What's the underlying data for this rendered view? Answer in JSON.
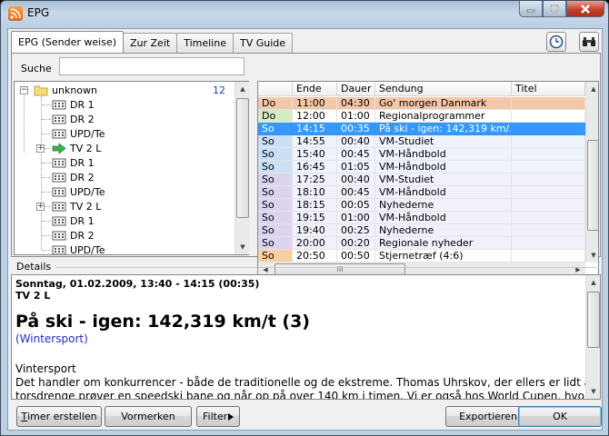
{
  "window": {
    "title": "EPG"
  },
  "tabs": [
    {
      "label": "EPG (Sender weise)",
      "active": true
    },
    {
      "label": "Zur Zeit",
      "active": false
    },
    {
      "label": "Timeline",
      "active": false
    },
    {
      "label": "TV Guide",
      "active": false
    }
  ],
  "toolbar": {
    "clock_icon": "clock-icon",
    "binoculars_icon": "binoculars-icon"
  },
  "search": {
    "label": "Suche",
    "value": ""
  },
  "tree": {
    "root": {
      "label": "unknown",
      "count": "12"
    },
    "items": [
      {
        "label": "DR 1"
      },
      {
        "label": "DR 2"
      },
      {
        "label": "UPD/Te"
      },
      {
        "label": "TV 2 L",
        "current": true
      },
      {
        "label": "DR 1"
      },
      {
        "label": "DR 2"
      },
      {
        "label": "UPD/Te"
      },
      {
        "label": "TV 2 L"
      },
      {
        "label": "DR 1"
      },
      {
        "label": "DR 2"
      },
      {
        "label": "UPD/Te"
      }
    ]
  },
  "grid": {
    "headers": [
      "",
      "Ende",
      "Dauer",
      "Sendung",
      "Titel"
    ],
    "rows": [
      {
        "day": "Do",
        "end": "11:00",
        "dur": "04:30",
        "show": "Go' morgen Danmark",
        "title": "",
        "style": "orange"
      },
      {
        "day": "Do",
        "end": "12:00",
        "dur": "01:00",
        "show": "Regionalprogrammer",
        "title": "",
        "style": "green"
      },
      {
        "day": "So",
        "end": "14:15",
        "dur": "00:35",
        "show": "På ski - igen: 142,319 km/...",
        "title": "",
        "style": "selected"
      },
      {
        "day": "So",
        "end": "14:55",
        "dur": "00:40",
        "show": "VM-Studiet",
        "title": "",
        "style": "blue"
      },
      {
        "day": "So",
        "end": "15:40",
        "dur": "00:45",
        "show": "VM-Håndbold",
        "title": "",
        "style": "blue"
      },
      {
        "day": "So",
        "end": "16:45",
        "dur": "01:05",
        "show": "VM-Håndbold",
        "title": "",
        "style": "blue"
      },
      {
        "day": "So",
        "end": "17:25",
        "dur": "00:40",
        "show": "VM-Studiet",
        "title": "",
        "style": "purple"
      },
      {
        "day": "So",
        "end": "18:10",
        "dur": "00:45",
        "show": "VM-Håndbold",
        "title": "",
        "style": "purple"
      },
      {
        "day": "So",
        "end": "18:15",
        "dur": "00:05",
        "show": "Nyhederne",
        "title": "",
        "style": "purple"
      },
      {
        "day": "So",
        "end": "19:15",
        "dur": "01:00",
        "show": "VM-Håndbold",
        "title": "",
        "style": "purple"
      },
      {
        "day": "So",
        "end": "19:40",
        "dur": "00:25",
        "show": "Nyhederne",
        "title": "",
        "style": "purple"
      },
      {
        "day": "So",
        "end": "20:00",
        "dur": "00:20",
        "show": "Regionale nyheder",
        "title": "",
        "style": "purple"
      },
      {
        "day": "So",
        "end": "20:50",
        "dur": "00:50",
        "show": "Stjernetræf (4:6)",
        "title": "",
        "style": "orange-day"
      }
    ],
    "hscroll_grip": "III"
  },
  "details": {
    "label": "Details",
    "datetime": "Sonntag, 01.02.2009, 13:40 - 14:15  (00:35)",
    "channel": "TV 2 L",
    "title": "På ski - igen: 142,319 km/t (3)",
    "genre": "(Wintersport)",
    "category": "Vintersport",
    "description_line1": "Det handler om konkurrencer - både de traditionelle og de ekstreme. Thomas Uhrskov, der ellers er lidt af en",
    "description_line2": "torsdrenge prøver en speedski bane og når op på over 140 km i timen. Vi er også hos World Cupen, hvor"
  },
  "buttons": {
    "record_prefix": "T",
    "record_rest": "imer erstellen",
    "mark": "Vormerken",
    "filter": "Filter",
    "export": "Exportieren",
    "ok": "OK"
  },
  "colors": {
    "selected": "#3399ff",
    "orange_row": "#f4c7a8",
    "orange_day": "#f8cfa0",
    "green_day": "#d3ecc3",
    "blue_row": "#eef3fd",
    "blue_day": "#cbdff7",
    "purple_day": "#dcd4ef",
    "purple_row": "#f2f0fa"
  }
}
